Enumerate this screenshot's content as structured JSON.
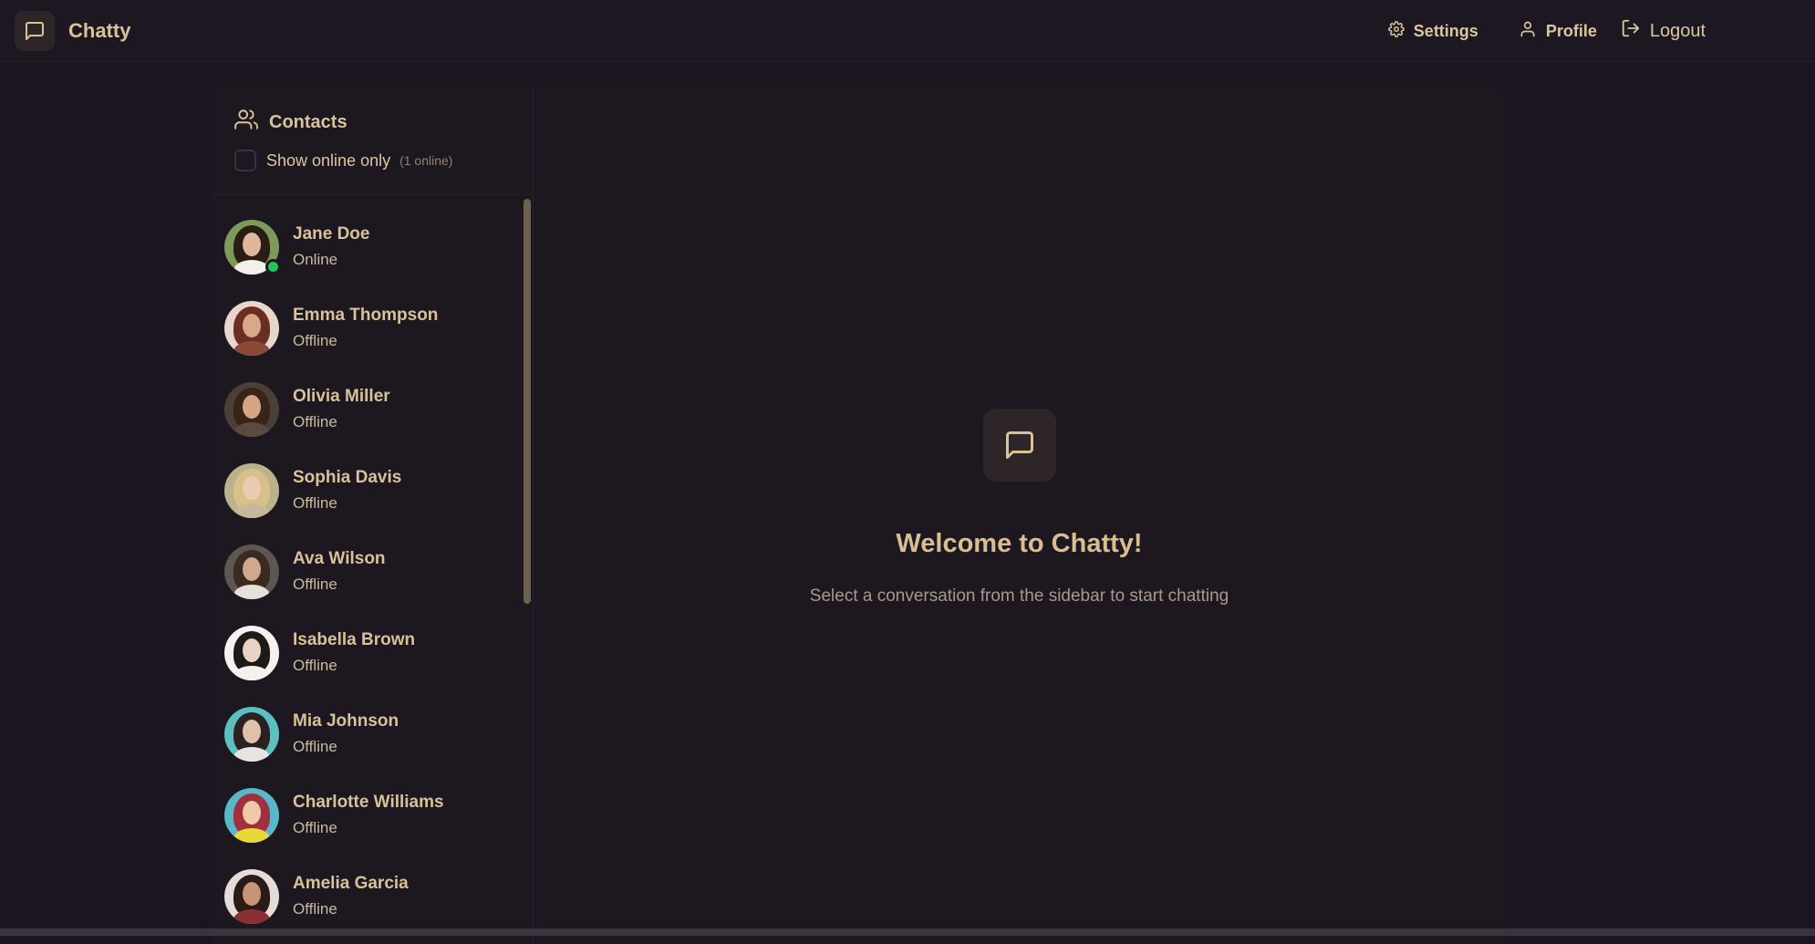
{
  "header": {
    "brand_name": "Chatty",
    "brand_icon": "message-square-icon",
    "nav": {
      "settings_label": "Settings",
      "profile_label": "Profile",
      "logout_label": "Logout"
    }
  },
  "sidebar": {
    "title": "Contacts",
    "filter_label": "Show online only",
    "online_count": "(1 online)",
    "contacts": [
      {
        "name": "Jane Doe",
        "status": "Online"
      },
      {
        "name": "Emma Thompson",
        "status": "Offline"
      },
      {
        "name": "Olivia Miller",
        "status": "Offline"
      },
      {
        "name": "Sophia Davis",
        "status": "Offline"
      },
      {
        "name": "Ava Wilson",
        "status": "Offline"
      },
      {
        "name": "Isabella Brown",
        "status": "Offline"
      },
      {
        "name": "Mia Johnson",
        "status": "Offline"
      },
      {
        "name": "Charlotte Williams",
        "status": "Offline"
      },
      {
        "name": "Amelia Garcia",
        "status": "Offline"
      }
    ]
  },
  "welcome": {
    "title": "Welcome to Chatty!",
    "subtitle": "Select a conversation from the sidebar to start chatting"
  },
  "colors": {
    "background": "#1b1520",
    "accent": "#d8c29a",
    "online": "#28c25a"
  }
}
